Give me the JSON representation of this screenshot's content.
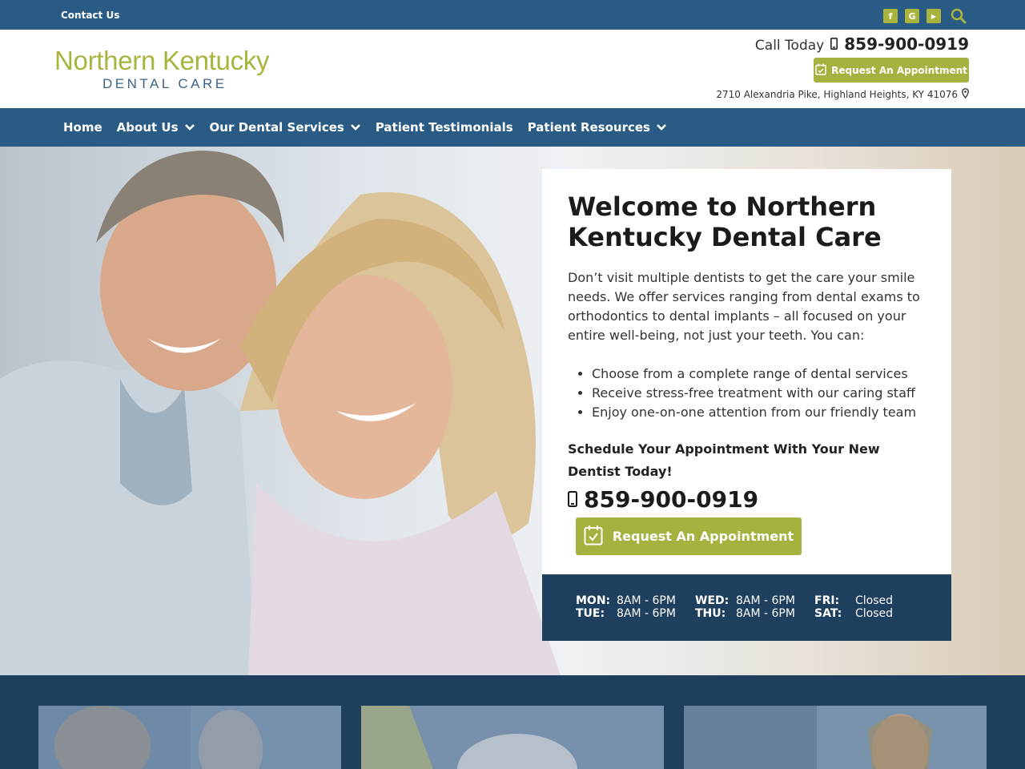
{
  "topbar": {
    "contact_label": "Contact Us",
    "social": [
      {
        "icon": "facebook-icon",
        "glyph": "f"
      },
      {
        "icon": "google-icon",
        "glyph": "G"
      },
      {
        "icon": "youtube-icon",
        "glyph": "▶"
      }
    ]
  },
  "header": {
    "logo_line1": "Northern Kentucky",
    "logo_line2": "DENTAL CARE",
    "call_label": "Call Today",
    "phone": "859-900-0919",
    "appointment_label": "Request An Appointment",
    "address": "2710 Alexandria Pike, Highland Heights, KY 41076"
  },
  "nav": {
    "items": [
      {
        "label": "Home",
        "dropdown": false
      },
      {
        "label": "About Us",
        "dropdown": true
      },
      {
        "label": "Our Dental Services",
        "dropdown": true
      },
      {
        "label": "Patient Testimonials",
        "dropdown": false
      },
      {
        "label": "Patient Resources",
        "dropdown": true
      }
    ]
  },
  "hero": {
    "title": "Welcome to Northern Kentucky Dental Care",
    "intro": "Don’t visit multiple dentists to get the care your smile needs. We offer services ranging from dental exams to orthodontics to dental implants – all focused on your entire well-being, not just your teeth. You can:",
    "bullets": [
      "Choose from a complete range of dental services",
      "Receive stress-free treatment with our caring staff",
      "Enjoy one-on-one attention from our friendly team"
    ],
    "schedule_text": "Schedule Your Appointment With Your New Dentist Today!",
    "phone": "859-900-0919",
    "button_label": "Request An Appointment"
  },
  "hours": [
    {
      "day": "MON:",
      "time": "8AM - 6PM"
    },
    {
      "day": "TUE:",
      "time": "8AM - 6PM"
    },
    {
      "day": "WED:",
      "time": "8AM - 6PM"
    },
    {
      "day": "THU:",
      "time": "8AM - 6PM"
    },
    {
      "day": "FRI:",
      "time": "Closed"
    },
    {
      "day": "SAT:",
      "time": "Closed"
    }
  ],
  "colors": {
    "brand_blue": "#2a5b85",
    "dark_navy": "#1f3f5e",
    "accent_green": "#a6b23f"
  }
}
